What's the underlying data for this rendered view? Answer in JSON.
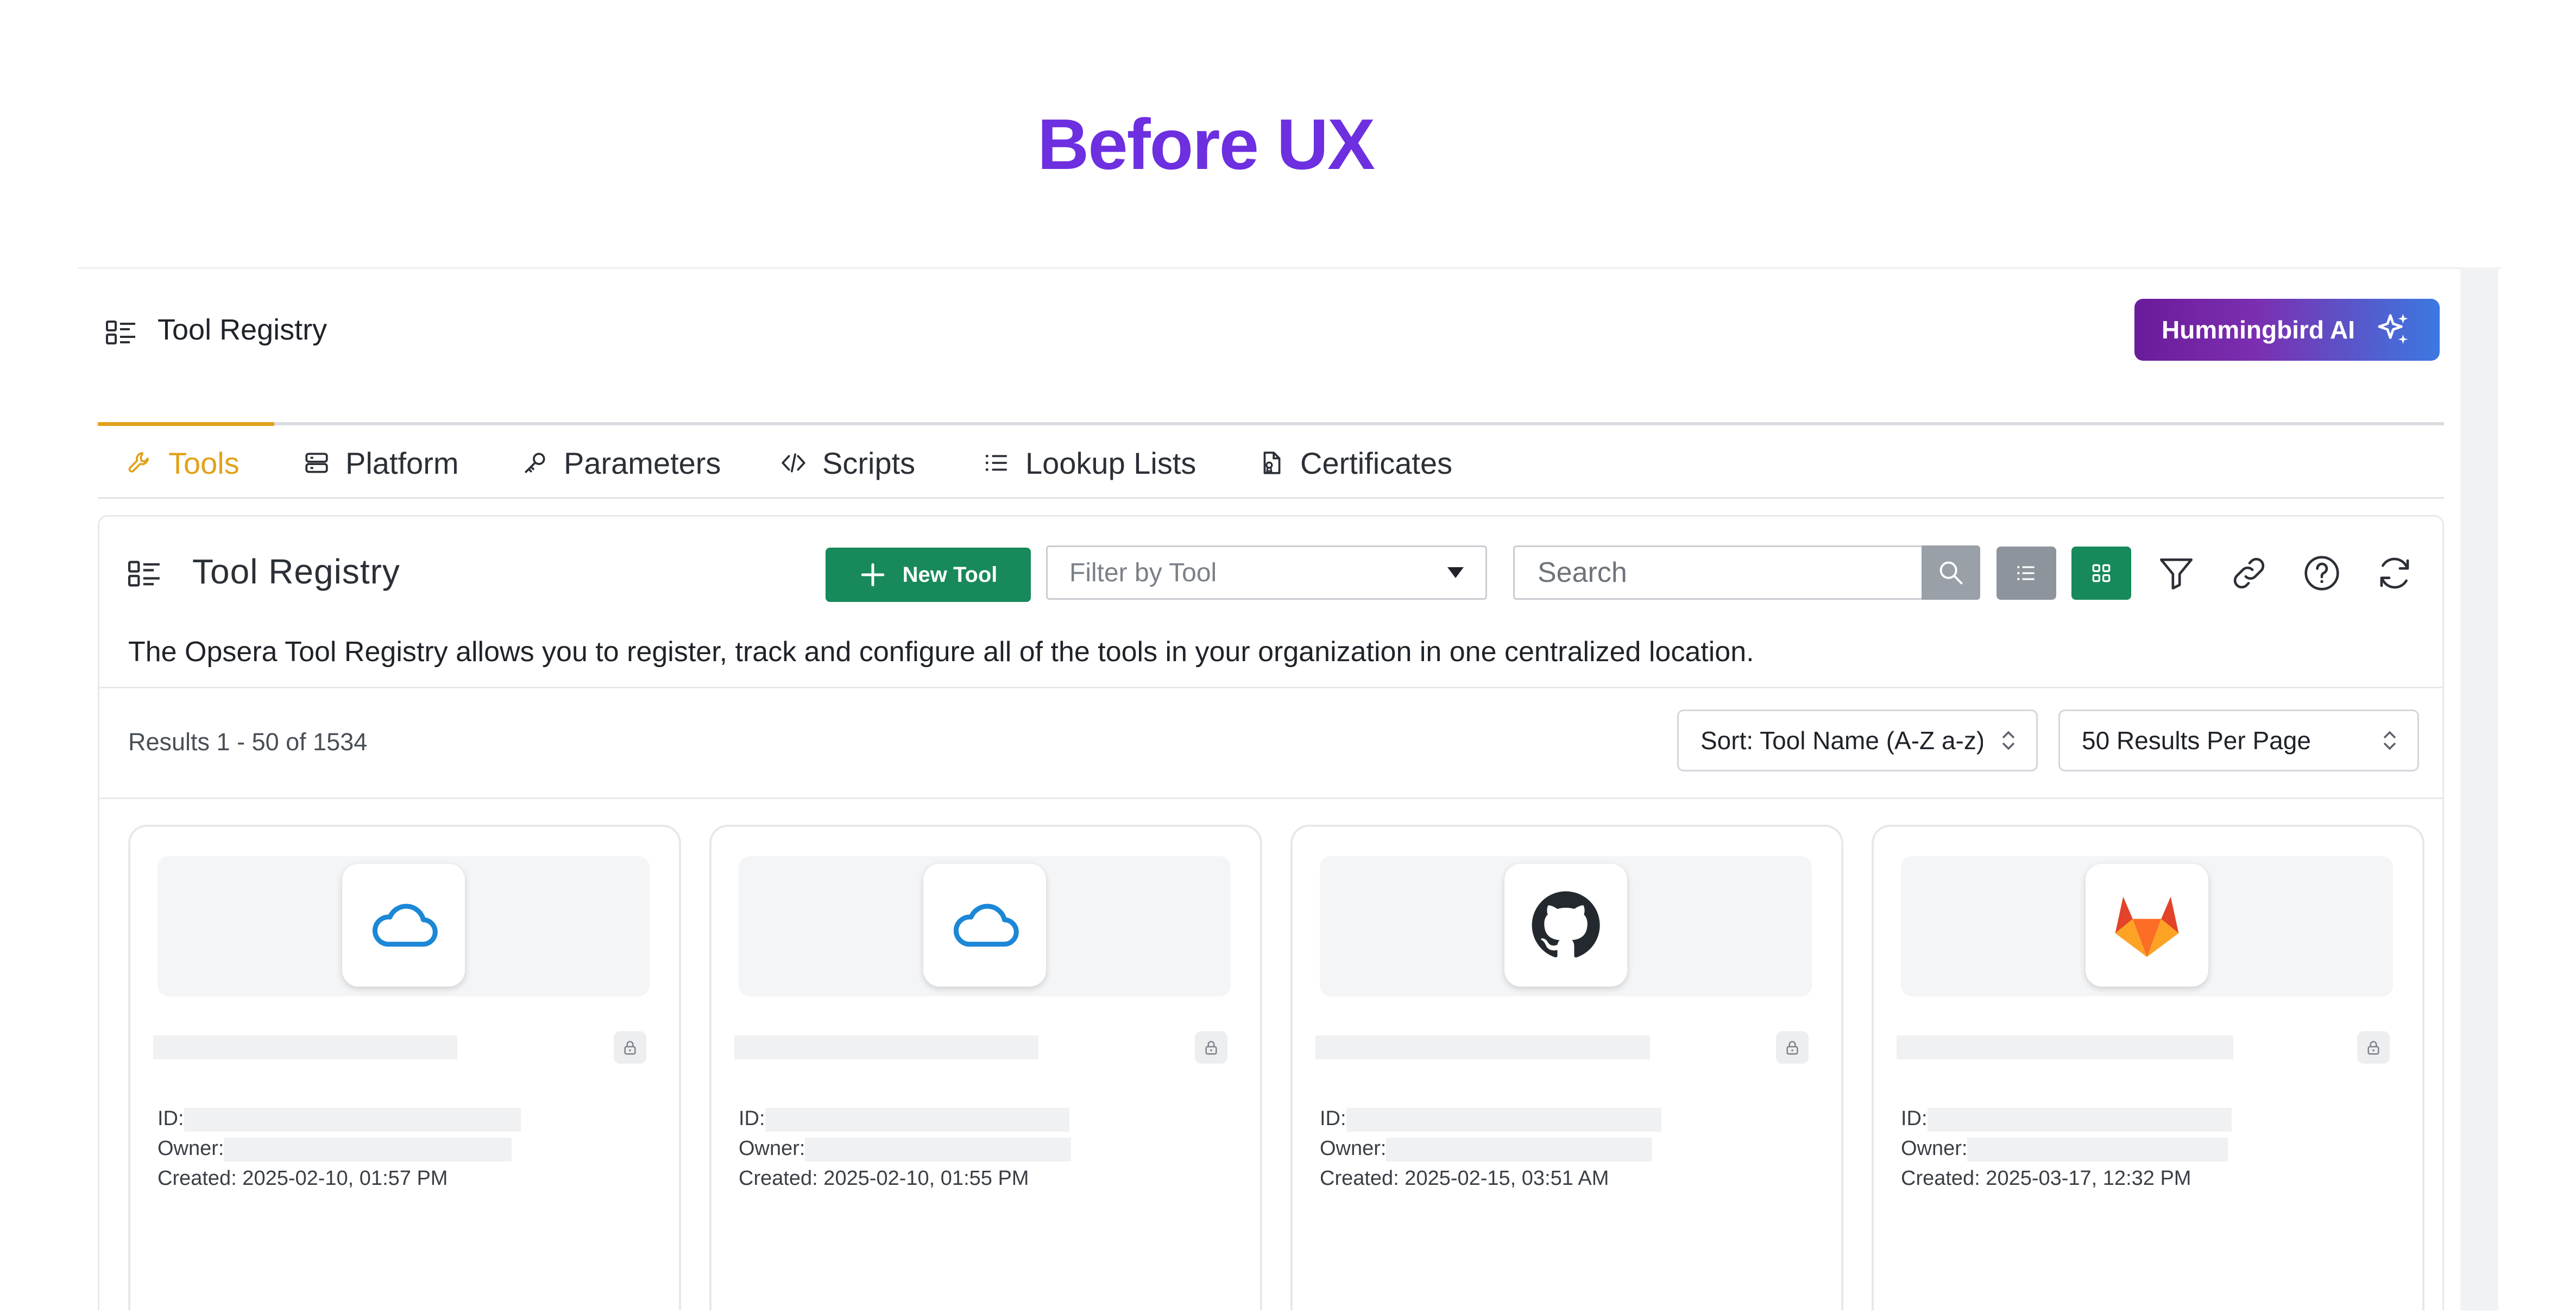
{
  "heading": "Before UX",
  "header": {
    "title": "Tool Registry",
    "ai_button": "Hummingbird AI"
  },
  "tabs": [
    {
      "label": "Tools",
      "icon": "wrench-icon",
      "active": true
    },
    {
      "label": "Platform",
      "icon": "server-icon"
    },
    {
      "label": "Parameters",
      "icon": "key-icon"
    },
    {
      "label": "Scripts",
      "icon": "code-icon"
    },
    {
      "label": "Lookup Lists",
      "icon": "list-icon"
    },
    {
      "label": "Certificates",
      "icon": "certificate-icon"
    }
  ],
  "panel": {
    "title": "Tool Registry",
    "new_tool": "New Tool",
    "filter_placeholder": "Filter by Tool",
    "search_placeholder": "Search",
    "description": "The Opsera Tool Registry allows you to register, track and configure all of the tools in your organization in one centralized location.",
    "results": "Results 1 - 50 of 1534",
    "sort": "Sort: Tool Name (A-Z a-z)",
    "per_page": "50 Results Per Page"
  },
  "colors": {
    "accent": "#e2a219",
    "primary": "#17895a",
    "heading": "#6d2fe0"
  },
  "cards": [
    {
      "logo": "cloud-icon",
      "id_label": "ID:",
      "owner_label": "Owner:",
      "created": "Created: 2025-02-10, 01:57 PM"
    },
    {
      "logo": "cloud-icon",
      "id_label": "ID:",
      "owner_label": "Owner:",
      "created": "Created: 2025-02-10, 01:55 PM"
    },
    {
      "logo": "github-icon",
      "id_label": "ID:",
      "owner_label": "Owner:",
      "created": "Created: 2025-02-15, 03:51 AM"
    },
    {
      "logo": "gitlab-icon",
      "id_label": "ID:",
      "owner_label": "Owner:",
      "created": "Created: 2025-03-17, 12:32 PM"
    }
  ]
}
